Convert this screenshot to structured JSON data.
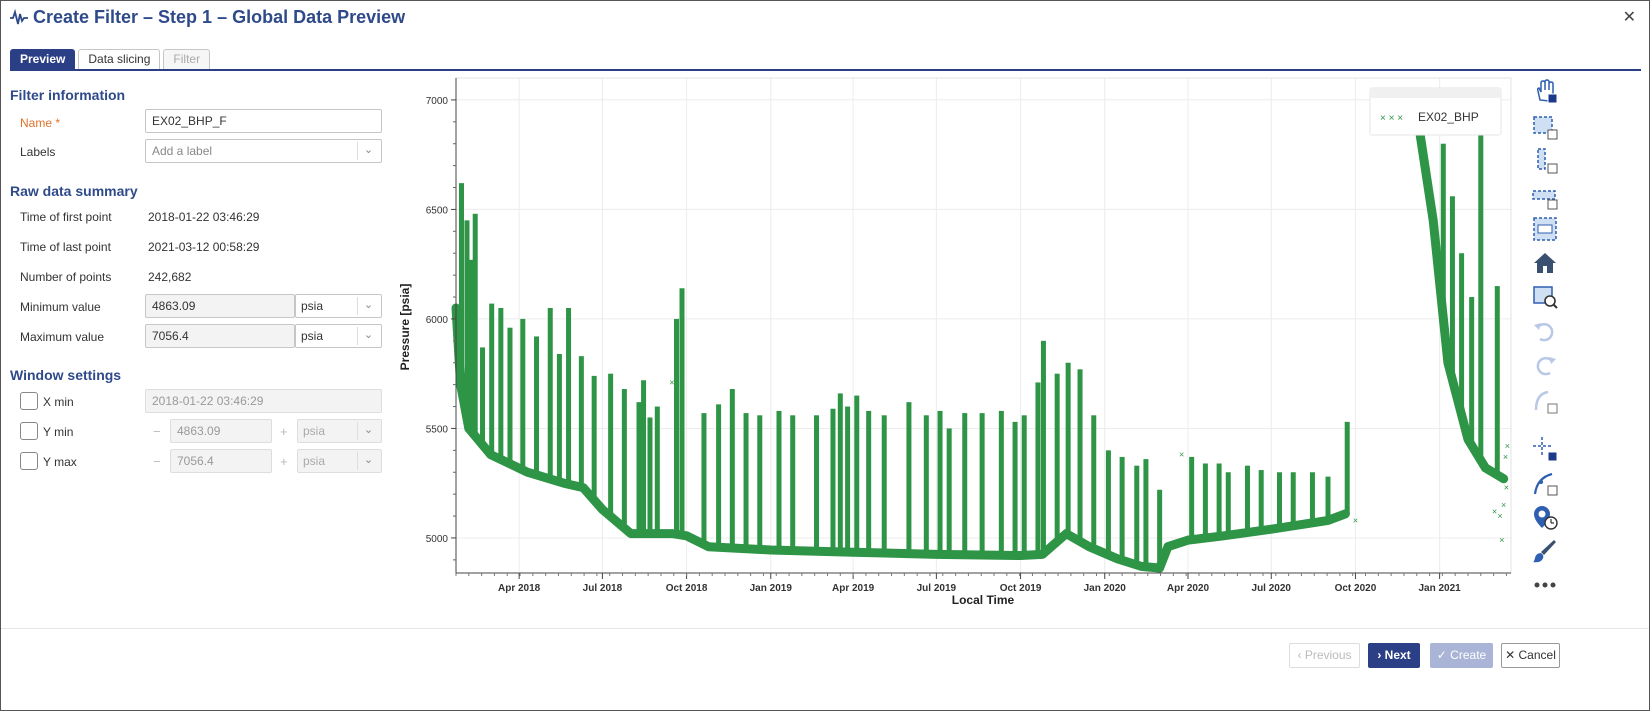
{
  "header": {
    "title": "Create Filter – Step 1 – Global Data Preview",
    "close_label": "✕"
  },
  "tabs": [
    {
      "label": "Preview",
      "state": "active"
    },
    {
      "label": "Data slicing",
      "state": "normal"
    },
    {
      "label": "Filter",
      "state": "disabled"
    }
  ],
  "filter_info": {
    "title": "Filter information",
    "name_label": "Name *",
    "name_value": "EX02_BHP_F",
    "labels_label": "Labels",
    "labels_placeholder": "Add a label"
  },
  "raw_summary": {
    "title": "Raw data summary",
    "first_label": "Time of first point",
    "first_value": "2018-01-22 03:46:29",
    "last_label": "Time of last point",
    "last_value": "2021-03-12 00:58:29",
    "count_label": "Number of points",
    "count_value": "242,682",
    "min_label": "Minimum value",
    "min_value": "4863.09",
    "min_unit": "psia",
    "max_label": "Maximum value",
    "max_value": "7056.4",
    "max_unit": "psia"
  },
  "window": {
    "title": "Window settings",
    "xmin_label": "X min",
    "xmin_value": "2018-01-22 03:46:29",
    "ymin_label": "Y min",
    "ymin_value": "4863.09",
    "ymin_unit": "psia",
    "ymax_label": "Y max",
    "ymax_value": "7056.4",
    "ymax_unit": "psia",
    "minus": "−",
    "plus": "+"
  },
  "footer": {
    "previous_label": "‹  Previous",
    "next_label": "›  Next",
    "create_label": "✓  Create",
    "cancel_label": "✕  Cancel"
  },
  "colors": {
    "accent": "#2b3f87",
    "series": "#2e9446",
    "title": "#2f4a8a",
    "required": "#e0722b"
  },
  "chart_data": {
    "type": "scatter",
    "ylabel": "Pressure [psia]",
    "xlabel": "Local Time",
    "ylim": [
      4840,
      7100
    ],
    "xlim": [
      "2018-01-22",
      "2021-03-20"
    ],
    "y_ticks": [
      5000,
      5500,
      6000,
      6500,
      7000
    ],
    "x_ticks": [
      {
        "date": "2018-04-01",
        "label": "Apr 2018"
      },
      {
        "date": "2018-07-01",
        "label": "Jul 2018"
      },
      {
        "date": "2018-10-01",
        "label": "Oct 2018"
      },
      {
        "date": "2019-01-01",
        "label": "Jan 2019"
      },
      {
        "date": "2019-04-01",
        "label": "Apr 2019"
      },
      {
        "date": "2019-07-01",
        "label": "Jul 2019"
      },
      {
        "date": "2019-10-01",
        "label": "Oct 2019"
      },
      {
        "date": "2020-01-01",
        "label": "Jan 2020"
      },
      {
        "date": "2020-04-01",
        "label": "Apr 2020"
      },
      {
        "date": "2020-07-01",
        "label": "Jul 2020"
      },
      {
        "date": "2020-10-01",
        "label": "Oct 2020"
      },
      {
        "date": "2021-01-01",
        "label": "Jan 2021"
      }
    ],
    "grid": true,
    "legend_position": "top-right",
    "series": [
      {
        "name": "EX02_BHP",
        "marker": "x",
        "color": "#2e9446",
        "baseline": [
          {
            "x": "2018-01-22",
            "y": 6050
          },
          {
            "x": "2018-01-27",
            "y": 5700
          },
          {
            "x": "2018-02-05",
            "y": 5500
          },
          {
            "x": "2018-03-01",
            "y": 5380
          },
          {
            "x": "2018-04-10",
            "y": 5300
          },
          {
            "x": "2018-05-20",
            "y": 5250
          },
          {
            "x": "2018-06-10",
            "y": 5230
          },
          {
            "x": "2018-07-01",
            "y": 5130
          },
          {
            "x": "2018-08-01",
            "y": 5020
          },
          {
            "x": "2018-09-15",
            "y": 5020
          },
          {
            "x": "2018-10-01",
            "y": 5010
          },
          {
            "x": "2018-10-25",
            "y": 4960
          },
          {
            "x": "2019-01-01",
            "y": 4945
          },
          {
            "x": "2019-04-01",
            "y": 4935
          },
          {
            "x": "2019-07-01",
            "y": 4925
          },
          {
            "x": "2019-10-01",
            "y": 4920
          },
          {
            "x": "2019-10-25",
            "y": 4925
          },
          {
            "x": "2019-11-20",
            "y": 5020
          },
          {
            "x": "2019-12-15",
            "y": 4960
          },
          {
            "x": "2020-01-15",
            "y": 4905
          },
          {
            "x": "2020-02-10",
            "y": 4870
          },
          {
            "x": "2020-03-01",
            "y": 4863
          },
          {
            "x": "2020-03-10",
            "y": 4960
          },
          {
            "x": "2020-04-01",
            "y": 4990
          },
          {
            "x": "2020-05-10",
            "y": 5010
          },
          {
            "x": "2020-07-01",
            "y": 5040
          },
          {
            "x": "2020-09-01",
            "y": 5080
          },
          {
            "x": "2020-09-20",
            "y": 5110
          }
        ],
        "baseline_late": [
          {
            "x": "2020-12-10",
            "y": 6860
          },
          {
            "x": "2020-12-25",
            "y": 6450
          },
          {
            "x": "2021-01-10",
            "y": 5800
          },
          {
            "x": "2021-02-01",
            "y": 5450
          },
          {
            "x": "2021-02-20",
            "y": 5320
          },
          {
            "x": "2021-03-12",
            "y": 5270
          }
        ],
        "spikes": [
          {
            "x": "2018-01-28",
            "y": 6620
          },
          {
            "x": "2018-02-03",
            "y": 6450
          },
          {
            "x": "2018-02-08",
            "y": 6270
          },
          {
            "x": "2018-02-12",
            "y": 6480
          },
          {
            "x": "2018-02-20",
            "y": 5870
          },
          {
            "x": "2018-03-02",
            "y": 6070
          },
          {
            "x": "2018-03-12",
            "y": 6050
          },
          {
            "x": "2018-03-22",
            "y": 5960
          },
          {
            "x": "2018-04-05",
            "y": 6000
          },
          {
            "x": "2018-04-20",
            "y": 5920
          },
          {
            "x": "2018-05-05",
            "y": 6050
          },
          {
            "x": "2018-05-15",
            "y": 5840
          },
          {
            "x": "2018-05-25",
            "y": 6050
          },
          {
            "x": "2018-06-08",
            "y": 5830
          },
          {
            "x": "2018-06-22",
            "y": 5740
          },
          {
            "x": "2018-07-10",
            "y": 5750
          },
          {
            "x": "2018-07-25",
            "y": 5680
          },
          {
            "x": "2018-08-10",
            "y": 5620
          },
          {
            "x": "2018-08-15",
            "y": 5720
          },
          {
            "x": "2018-08-22",
            "y": 5550
          },
          {
            "x": "2018-08-30",
            "y": 5600
          },
          {
            "x": "2018-09-20",
            "y": 6000
          },
          {
            "x": "2018-09-26",
            "y": 6140
          },
          {
            "x": "2018-10-20",
            "y": 5570
          },
          {
            "x": "2018-11-05",
            "y": 5610
          },
          {
            "x": "2018-11-20",
            "y": 5680
          },
          {
            "x": "2018-12-05",
            "y": 5570
          },
          {
            "x": "2018-12-20",
            "y": 5560
          },
          {
            "x": "2019-01-10",
            "y": 5580
          },
          {
            "x": "2019-01-25",
            "y": 5560
          },
          {
            "x": "2019-02-20",
            "y": 5560
          },
          {
            "x": "2019-03-10",
            "y": 5590
          },
          {
            "x": "2019-03-18",
            "y": 5660
          },
          {
            "x": "2019-03-26",
            "y": 5600
          },
          {
            "x": "2019-04-05",
            "y": 5650
          },
          {
            "x": "2019-04-18",
            "y": 5580
          },
          {
            "x": "2019-05-05",
            "y": 5560
          },
          {
            "x": "2019-06-01",
            "y": 5620
          },
          {
            "x": "2019-06-20",
            "y": 5560
          },
          {
            "x": "2019-07-05",
            "y": 5580
          },
          {
            "x": "2019-07-15",
            "y": 5500
          },
          {
            "x": "2019-08-01",
            "y": 5570
          },
          {
            "x": "2019-08-20",
            "y": 5570
          },
          {
            "x": "2019-09-10",
            "y": 5580
          },
          {
            "x": "2019-09-25",
            "y": 5530
          },
          {
            "x": "2019-10-05",
            "y": 5560
          },
          {
            "x": "2019-10-20",
            "y": 5710
          },
          {
            "x": "2019-10-26",
            "y": 5900
          },
          {
            "x": "2019-11-10",
            "y": 5750
          },
          {
            "x": "2019-11-22",
            "y": 5800
          },
          {
            "x": "2019-12-05",
            "y": 5770
          },
          {
            "x": "2019-12-20",
            "y": 5560
          },
          {
            "x": "2020-01-05",
            "y": 5400
          },
          {
            "x": "2020-01-20",
            "y": 5370
          },
          {
            "x": "2020-02-05",
            "y": 5330
          },
          {
            "x": "2020-02-15",
            "y": 5360
          },
          {
            "x": "2020-03-01",
            "y": 5220
          },
          {
            "x": "2020-04-05",
            "y": 5370
          },
          {
            "x": "2020-04-20",
            "y": 5340
          },
          {
            "x": "2020-05-05",
            "y": 5340
          },
          {
            "x": "2020-05-15",
            "y": 5300
          },
          {
            "x": "2020-06-05",
            "y": 5330
          },
          {
            "x": "2020-06-20",
            "y": 5310
          },
          {
            "x": "2020-07-10",
            "y": 5300
          },
          {
            "x": "2020-07-25",
            "y": 5300
          },
          {
            "x": "2020-08-15",
            "y": 5300
          },
          {
            "x": "2020-09-01",
            "y": 5280
          },
          {
            "x": "2020-09-22",
            "y": 5530
          },
          {
            "x": "2021-01-05",
            "y": 6800
          },
          {
            "x": "2021-01-15",
            "y": 6560
          },
          {
            "x": "2021-01-25",
            "y": 6300
          },
          {
            "x": "2021-02-05",
            "y": 6100
          },
          {
            "x": "2021-02-15",
            "y": 6850
          },
          {
            "x": "2021-03-05",
            "y": 6150
          }
        ],
        "outliers": [
          {
            "x": "2018-09-15",
            "y": 5710
          },
          {
            "x": "2020-03-25",
            "y": 5380
          },
          {
            "x": "2020-10-01",
            "y": 5080
          },
          {
            "x": "2021-03-02",
            "y": 5120
          },
          {
            "x": "2021-03-08",
            "y": 5100
          },
          {
            "x": "2021-03-10",
            "y": 4990
          },
          {
            "x": "2021-03-12",
            "y": 5150
          },
          {
            "x": "2021-03-14",
            "y": 5370
          },
          {
            "x": "2021-03-15",
            "y": 5230
          },
          {
            "x": "2021-03-16",
            "y": 5420
          }
        ]
      }
    ]
  }
}
